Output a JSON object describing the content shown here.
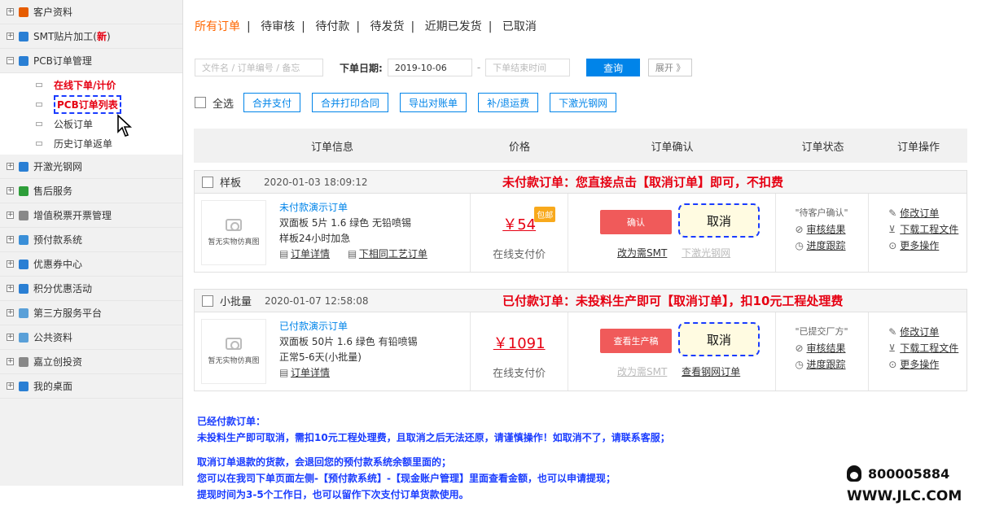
{
  "sidebar": {
    "items": [
      {
        "label": "客户资料",
        "color": "#e65c00"
      },
      {
        "label": "SMT贴片加工(",
        "suffix": "新",
        "tail": ")",
        "color": "#2a7fd4"
      },
      {
        "label": "PCB订单管理",
        "color": "#2a7fd4"
      }
    ],
    "sub": [
      "在线下单/计价",
      "PCB订单列表",
      "公板订单",
      "历史订单返单"
    ],
    "items2": [
      {
        "label": "开激光钢网",
        "color": "#2a7fd4"
      },
      {
        "label": "售后服务",
        "color": "#2e9e3a"
      },
      {
        "label": "增值税票开票管理",
        "color": "#888888"
      },
      {
        "label": "预付款系统",
        "color": "#3a8fd8"
      },
      {
        "label": "优惠券中心",
        "color": "#2a7fd4"
      },
      {
        "label": "积分优惠活动",
        "color": "#2a7fd4"
      },
      {
        "label": "第三方服务平台",
        "color": "#5aa0d8"
      },
      {
        "label": "公共资料",
        "color": "#5aa0d8"
      },
      {
        "label": "嘉立创投资",
        "color": "#888888"
      },
      {
        "label": "我的桌面",
        "color": "#2a7fd4"
      }
    ]
  },
  "tabs": [
    "所有订单",
    "待审核",
    "待付款",
    "待发货",
    "近期已发货",
    "已取消"
  ],
  "filter": {
    "search_placeholder": "文件名 / 订单编号 / 备忘",
    "date_label": "下单日期:",
    "date_start": "2019-10-06",
    "dash": "-",
    "date_end_placeholder": "下单结束时间",
    "query": "查询",
    "expand": "展开 》"
  },
  "actions": {
    "select_all": "全选",
    "buttons": [
      "合并支付",
      "合并打印合同",
      "导出对账单",
      "补/退运费",
      "下激光钢网"
    ]
  },
  "table_headers": [
    "订单信息",
    "价格",
    "订单确认",
    "订单状态",
    "订单操作"
  ],
  "orders": [
    {
      "type": "样板",
      "time": "2020-01-03 18:09:12",
      "notice": "未付款订单：您直接点击【取消订单】即可，不扣费",
      "thumb_text": "暂无实物仿真图",
      "name": "未付款演示订单",
      "spec": "双面板  5片  1.6  绿色  无铅喷锡",
      "lead": "样板24小时加急",
      "link1": "订单详情",
      "link2": "下相同工艺订单",
      "price": "￥54",
      "badge": "包邮",
      "pay_note": "在线支付价",
      "confirm_btn": "确认",
      "cancel_btn": "取消",
      "link_smt": "改为需SMT",
      "link_stencil": "下激光钢网",
      "status": "\"待客户确认\"",
      "audit": "审核结果",
      "progress": "进度跟踪",
      "op1": "修改订单",
      "op2": "下载工程文件",
      "op3": "更多操作"
    },
    {
      "type": "小批量",
      "time": "2020-01-07 12:58:08",
      "notice": "已付款订单：未投料生产即可【取消订单】，扣10元工程处理费",
      "thumb_text": "暂无实物仿真图",
      "name": "已付款演示订单",
      "spec": "双面板  50片  1.6  绿色  有铅喷锡",
      "lead": "正常5-6天(小批量)",
      "link1": "订单详情",
      "price": "￥1091",
      "pay_note": "在线支付价",
      "confirm_btn": "查看生产稿",
      "cancel_btn": "取消",
      "link_smt": "改为需SMT",
      "link_stencil": "查看钢网订单",
      "status": "\"已提交厂方\"",
      "audit": "审核结果",
      "progress": "进度跟踪",
      "op1": "修改订单",
      "op2": "下载工程文件",
      "op3": "更多操作"
    }
  ],
  "bottom_notes": [
    "已经付款订单：",
    "未投料生产即可取消，需扣10元工程处理费，且取消之后无法还原，请谨慎操作！如取消不了，请联系客服；",
    "取消订单退款的货款，会退回您的预付款系统余额里面的；",
    "您可以在我司下单页面左侧-【预付款系统】-【现金账户管理】里面查看金额，也可以申请提现；",
    "提现时间为3-5个工作日，也可以留作下次支付订单货款使用。"
  ],
  "contact": {
    "phone": "800005884",
    "website": "WWW.JLC.COM"
  },
  "colors": {
    "accent": "#0084e9",
    "alert": "#e60012",
    "tab_active": "#ff6600",
    "highlight_box": "#1a3cff"
  }
}
